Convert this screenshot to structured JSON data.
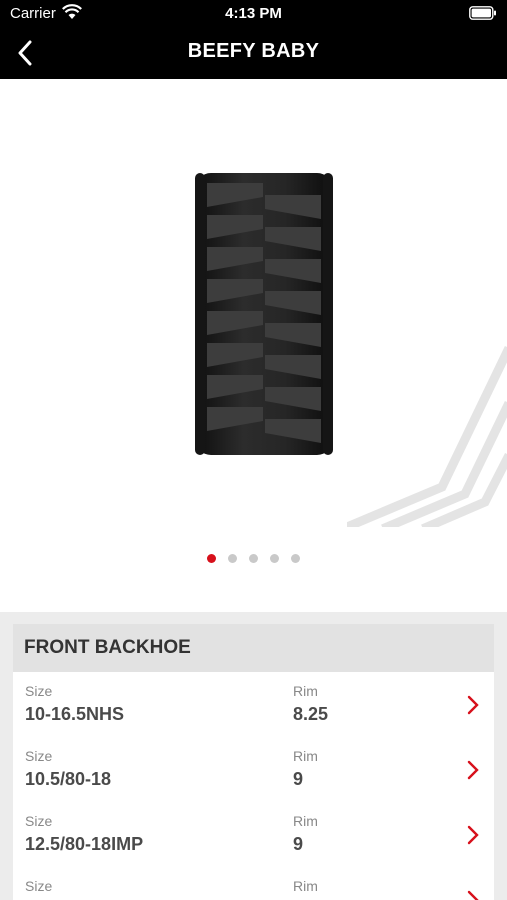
{
  "status_bar": {
    "carrier": "Carrier",
    "time": "4:13 PM"
  },
  "header": {
    "title": "BEEFY BABY"
  },
  "carousel": {
    "page_count": 5,
    "active_index": 0
  },
  "section": {
    "title": "FRONT BACKHOE",
    "size_label": "Size",
    "rim_label": "Rim",
    "rows": [
      {
        "size": "10-16.5NHS",
        "rim": "8.25"
      },
      {
        "size": "10.5/80-18",
        "rim": "9"
      },
      {
        "size": "12.5/80-18IMP",
        "rim": "9"
      },
      {
        "size": "",
        "rim": ""
      }
    ]
  },
  "colors": {
    "accent": "#d7101b",
    "bar": "#000000"
  }
}
